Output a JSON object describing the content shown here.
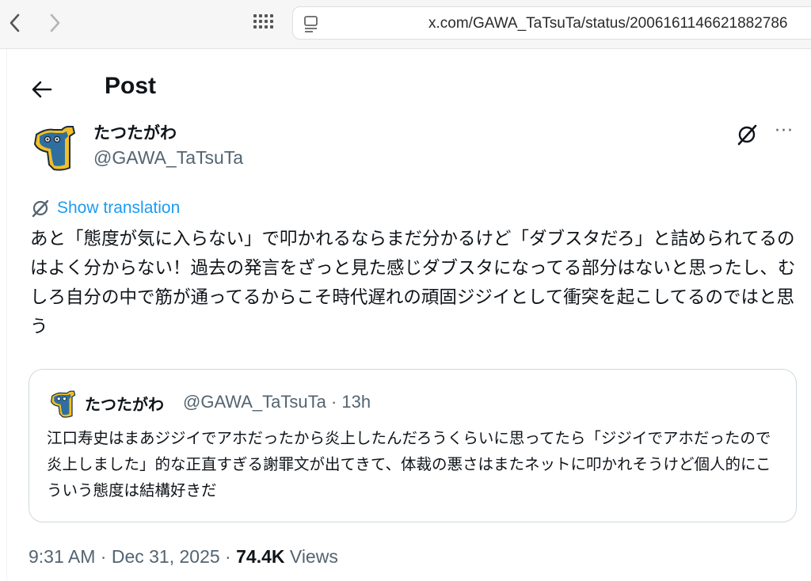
{
  "browser": {
    "url": "x.com/GAWA_TaTsuTa/status/2006161146621882786",
    "icons": {
      "back": "chevron-left-icon",
      "forward": "chevron-right-icon",
      "tabs": "grid-icon",
      "reader": "reader-icon"
    }
  },
  "header": {
    "title": "Post",
    "back_icon": "arrow-left-icon"
  },
  "author": {
    "display_name": "たつたがわ",
    "handle": "@GAWA_TaTsuTa"
  },
  "actions": {
    "grok_icon": "grok-icon",
    "more_label": "···"
  },
  "translation": {
    "label": "Show translation"
  },
  "tweet": {
    "text": "あと「態度が気に入らない」で叩かれるならまだ分かるけど「ダブスタだろ」と詰められてるのはよく分からない！過去の発言をざっと見た感じダブスタになってる部分はないと思ったし、むしろ自分の中で筋が通ってるからこそ時代遅れの頑固ジジイとして衝突を起こしてるのではと思う"
  },
  "quote": {
    "display_name": "たつたがわ",
    "handle_time": "@GAWA_TaTsuTa · 13h",
    "text": "江口寿史はまあジジイでアホだったから炎上したんだろうくらいに思ってたら「ジジイでアホだったので炎上しました」的な正直すぎる謝罪文が出てきて、体裁の悪さはまたネットに叩かれそうけど個人的にこういう態度は結構好きだ"
  },
  "meta": {
    "time": "9:31 AM",
    "date": "Dec 31, 2025",
    "separator": " · ",
    "views_count": "74.4K",
    "views_label": "Views"
  },
  "colors": {
    "accent": "#1d9bf0",
    "text_primary": "#0f1419",
    "text_secondary": "#536471",
    "border": "#cfd9de"
  }
}
